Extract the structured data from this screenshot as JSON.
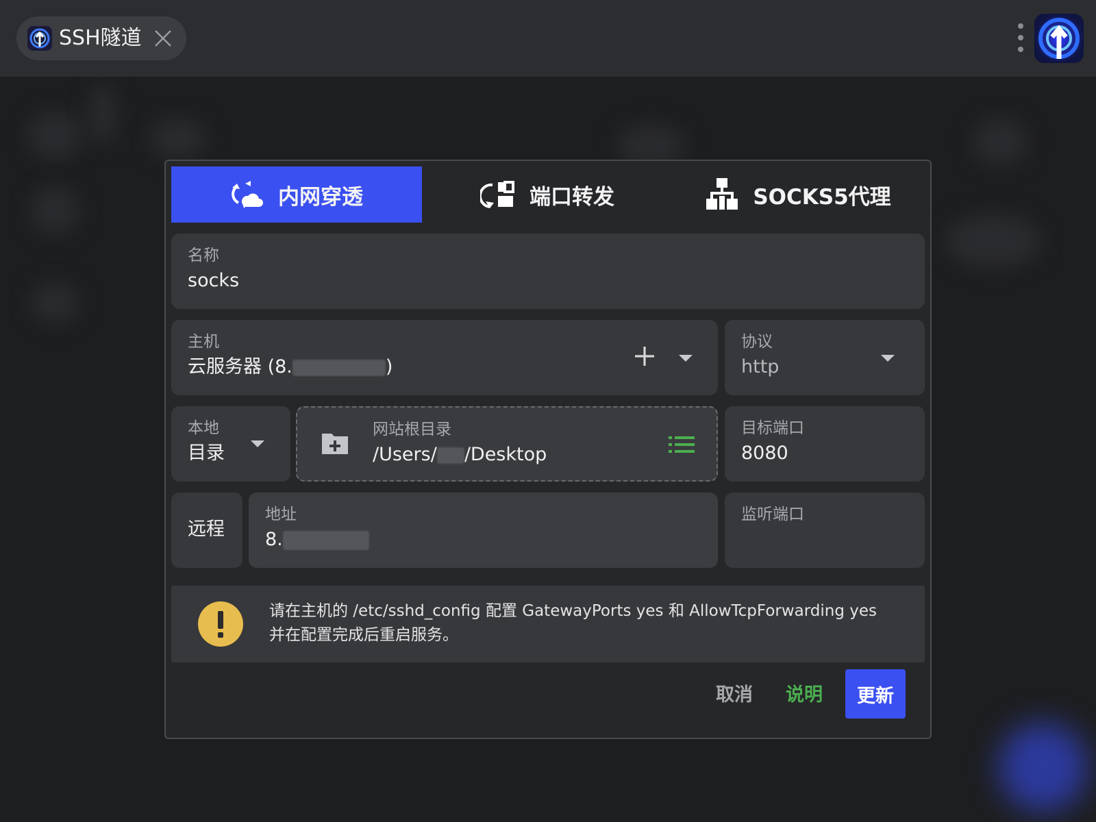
{
  "window": {
    "tab_title": "SSH隧道",
    "tab_icon": "tunnel-app-icon",
    "close_icon": "close-icon",
    "menu_icon": "kebab-menu-icon",
    "app_logo": "tunnel-app-logo"
  },
  "dialog": {
    "tabs": [
      {
        "label": "内网穿透",
        "icon": "cloud-sync-icon",
        "active": true
      },
      {
        "label": "端口转发",
        "icon": "port-forward-icon",
        "active": false
      },
      {
        "label": "SOCKS5代理",
        "icon": "network-tree-icon",
        "active": false
      }
    ],
    "name": {
      "label": "名称",
      "value": "socks"
    },
    "host": {
      "label": "主机",
      "value_prefix": "云服务器 (8.",
      "value_masked": "",
      "value_suffix": ")",
      "add_icon": "plus-icon",
      "dropdown_icon": "chevron-down-icon"
    },
    "protocol": {
      "label": "协议",
      "value": "http",
      "dropdown_icon": "chevron-down-icon"
    },
    "local": {
      "label": "本地",
      "value": "目录",
      "dropdown_icon": "chevron-down-icon"
    },
    "web_root": {
      "label": "网站根目录",
      "value_prefix": "/Users/",
      "value_masked": "",
      "value_suffix": "/Desktop",
      "folder_icon": "folder-add-icon",
      "list_icon": "list-icon"
    },
    "target_port": {
      "label": "目标端口",
      "value": "8080"
    },
    "remote": {
      "label": "远程"
    },
    "address": {
      "label": "地址",
      "value_prefix": "8.",
      "value_masked": ""
    },
    "listen_port": {
      "label": "监听端口",
      "value": ""
    },
    "notice": {
      "icon": "warning-icon",
      "line1": "请在主机的 /etc/sshd_config 配置 GatewayPorts yes 和 AllowTcpForwarding yes",
      "line2": "并在配置完成后重启服务。"
    },
    "buttons": {
      "cancel": "取消",
      "help": "说明",
      "update": "更新"
    }
  },
  "colors": {
    "accent": "#3b50f0",
    "help_green": "#4caf50",
    "warning_yellow": "#e8bd4f",
    "list_green": "#4caf50"
  }
}
